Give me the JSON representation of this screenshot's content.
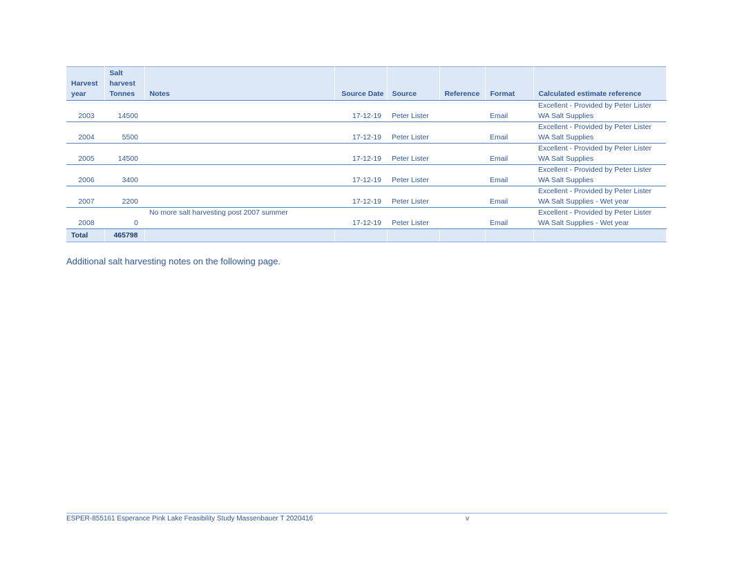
{
  "table": {
    "headers": {
      "year": "Harvest\nyear",
      "tonnes": "Salt\nharvest\nTonnes",
      "notes": "Notes",
      "source_date": "Source Date",
      "source": "Source",
      "reference": "Reference",
      "format": "Format",
      "calc_ref": "Calculated estimate reference"
    },
    "rows": [
      {
        "year": "2003",
        "tonnes": "14500",
        "notes": "",
        "source_date": "17-12-19",
        "source": "Peter Lister",
        "reference": "",
        "format": "Email",
        "calc_line1": "Excellent - Provided by Peter Lister",
        "calc_line2": "WA Salt Supplies"
      },
      {
        "year": "2004",
        "tonnes": "5500",
        "notes": "",
        "source_date": "17-12-19",
        "source": "Peter Lister",
        "reference": "",
        "format": "Email",
        "calc_line1": "Excellent - Provided by Peter Lister",
        "calc_line2": "WA Salt Supplies"
      },
      {
        "year": "2005",
        "tonnes": "14500",
        "notes": "",
        "source_date": "17-12-19",
        "source": "Peter Lister",
        "reference": "",
        "format": "Email",
        "calc_line1": "Excellent - Provided by Peter Lister",
        "calc_line2": "WA Salt Supplies"
      },
      {
        "year": "2006",
        "tonnes": "3400",
        "notes": "",
        "source_date": "17-12-19",
        "source": "Peter Lister",
        "reference": "",
        "format": "Email",
        "calc_line1": "Excellent - Provided by Peter Lister",
        "calc_line2": "WA Salt Supplies"
      },
      {
        "year": "2007",
        "tonnes": "2200",
        "notes": "",
        "source_date": "17-12-19",
        "source": "Peter Lister",
        "reference": "",
        "format": "Email",
        "calc_line1": "Excellent - Provided by Peter Lister",
        "calc_line2": "WA Salt Supplies - Wet year"
      },
      {
        "year": "2008",
        "tonnes": "0",
        "notes": "No more salt harvesting post 2007 summer",
        "source_date": "17-12-19",
        "source": "Peter Lister",
        "reference": "",
        "format": "Email",
        "calc_line1": "Excellent - Provided by Peter Lister",
        "calc_line2": "WA Salt Supplies - Wet year"
      }
    ],
    "total": {
      "label": "Total",
      "value": "465798"
    }
  },
  "note": "Additional salt harvesting notes on the following page.",
  "footer": {
    "document": "ESPER-855161 Esperance Pink Lake Feasibility Study Massenbauer T 2020416",
    "page": "v"
  }
}
